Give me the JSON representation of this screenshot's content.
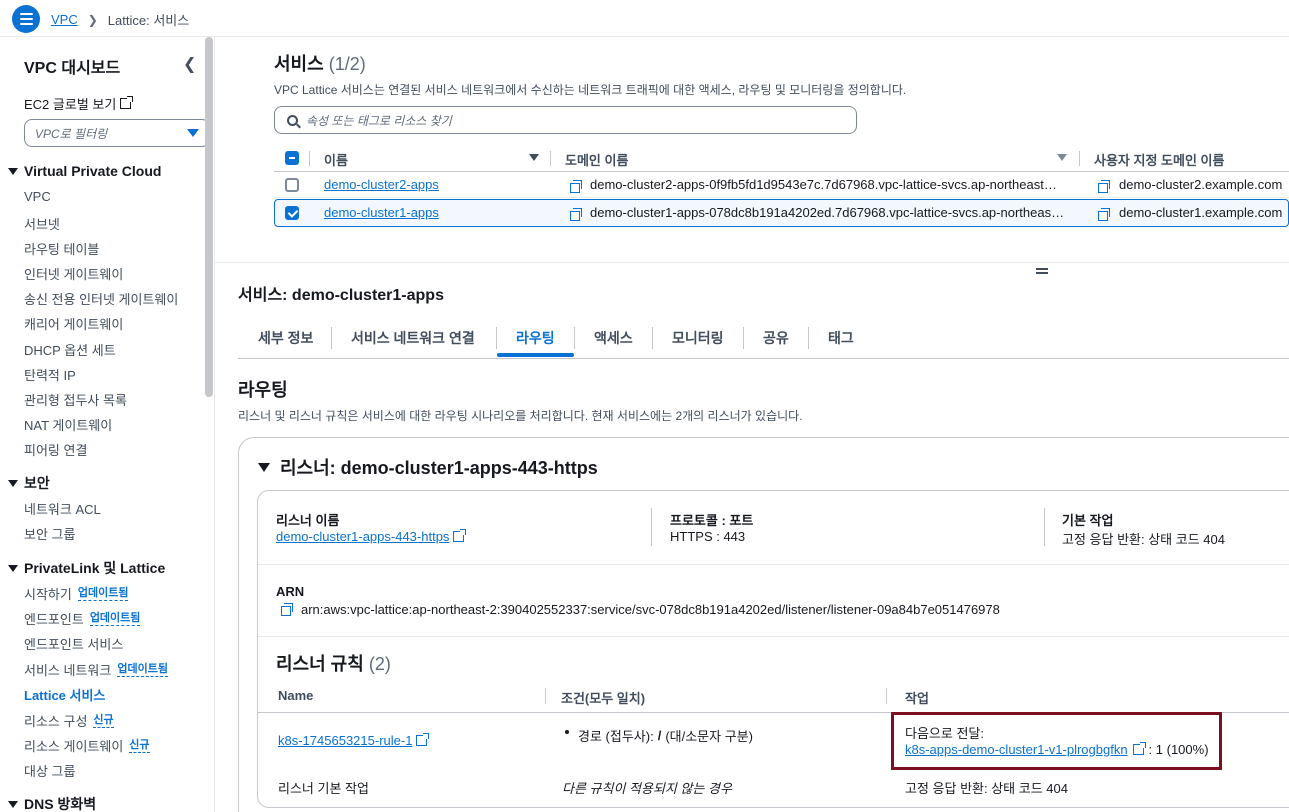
{
  "breadcrumb": {
    "vpc": "VPC",
    "current": "Lattice: 서비스"
  },
  "sidebar": {
    "title": "VPC 대시보드",
    "ec2_link": "EC2 글로벌 보기",
    "filter_placeholder": "VPC로 필터링",
    "sections": {
      "vpc": "Virtual Private Cloud",
      "security": "보안",
      "privatelink": "PrivateLink 및 Lattice",
      "dns": "DNS 방화벽"
    },
    "vpc_items": [
      "VPC",
      "서브넷",
      "라우팅 테이블",
      "인터넷 게이트웨이",
      "송신 전용 인터넷 게이트웨이",
      "캐리어 게이트웨이",
      "DHCP 옵션 세트",
      "탄력적 IP",
      "관리형 접두사 목록",
      "NAT 게이트웨이",
      "피어링 연결"
    ],
    "security_items": [
      "네트워크 ACL",
      "보안 그룹"
    ],
    "privatelink_items": [
      {
        "label": "시작하기",
        "badge": "업데이트됨"
      },
      {
        "label": "엔드포인트",
        "badge": "업데이트됨"
      },
      {
        "label": "엔드포인트 서비스",
        "badge": ""
      },
      {
        "label": "서비스 네트워크",
        "badge": "업데이트됨"
      },
      {
        "label": "Lattice 서비스",
        "badge": ""
      },
      {
        "label": "리소스 구성",
        "badge": "신규"
      },
      {
        "label": "리소스 게이트웨이",
        "badge": "신규"
      },
      {
        "label": "대상 그룹",
        "badge": ""
      }
    ]
  },
  "services": {
    "title": "서비스",
    "count": "(1/2)",
    "description": "VPC Lattice 서비스는 연결된 서비스 네트워크에서 수신하는 네트워크 트래픽에 대한 액세스, 라우팅 및 모니터링을 정의합니다.",
    "search_placeholder": "속성 또는 태그로 리소스 찾기",
    "columns": {
      "name": "이름",
      "domain": "도메인 이름",
      "custom_domain": "사용자 지정 도메인 이름"
    },
    "rows": [
      {
        "name": "demo-cluster2-apps",
        "domain": "demo-cluster2-apps-0f9fb5fd1d9543e7c.7d67968.vpc-lattice-svcs.ap-northeast…",
        "custom_domain": "demo-cluster2.example.com"
      },
      {
        "name": "demo-cluster1-apps",
        "domain": "demo-cluster1-apps-078dc8b191a4202ed.7d67968.vpc-lattice-svcs.ap-northeas…",
        "custom_domain": "demo-cluster1.example.com"
      }
    ]
  },
  "detail": {
    "title": "서비스: demo-cluster1-apps",
    "tabs": [
      "세부 정보",
      "서비스 네트워크 연결",
      "라우팅",
      "액세스",
      "모니터링",
      "공유",
      "태그"
    ],
    "routing_title": "라우팅",
    "routing_desc": "리스너 및 리스너 규칙은 서비스에 대한 라우팅 시나리오를 처리합니다. 현재 서비스에는 2개의 리스너가 있습니다.",
    "listener_title": "리스너: demo-cluster1-apps-443-https",
    "listener_name_label": "리스너 이름",
    "listener_name": "demo-cluster1-apps-443-https",
    "protocol_label": "프로토콜 : 포트",
    "protocol": "HTTPS : 443",
    "default_action_label": "기본 작업",
    "default_action": "고정 응답 반환: 상태 코드 404",
    "arn_label": "ARN",
    "arn": "arn:aws:vpc-lattice:ap-northeast-2:390402552337:service/svc-078dc8b191a4202ed/listener/listener-09a84b7e051476978",
    "rules_title": "리스너 규칙",
    "rules_count": "(2)",
    "rules_cols": {
      "name": "Name",
      "condition": "조건(모두 일치)",
      "action": "작업"
    },
    "rule1": {
      "name": "k8s-1745653215-rule-1",
      "condition_prefix": "경로 (접두사): ",
      "condition_bold": "/",
      "condition_suffix": " (대/소문자 구분)",
      "action_label": "다음으로 전달:",
      "target": "k8s-apps-demo-cluster1-v1-plrogbgfkn",
      "weight": ": 1 (100%)"
    },
    "rule2": {
      "name": "리스너 기본 작업",
      "condition": "다른 규칙이 적용되지 않는 경우",
      "action": "고정 응답 반환: 상태 코드 404"
    }
  },
  "colors": {
    "accent": "#0972d3",
    "highlight_border": "#7b1020"
  }
}
